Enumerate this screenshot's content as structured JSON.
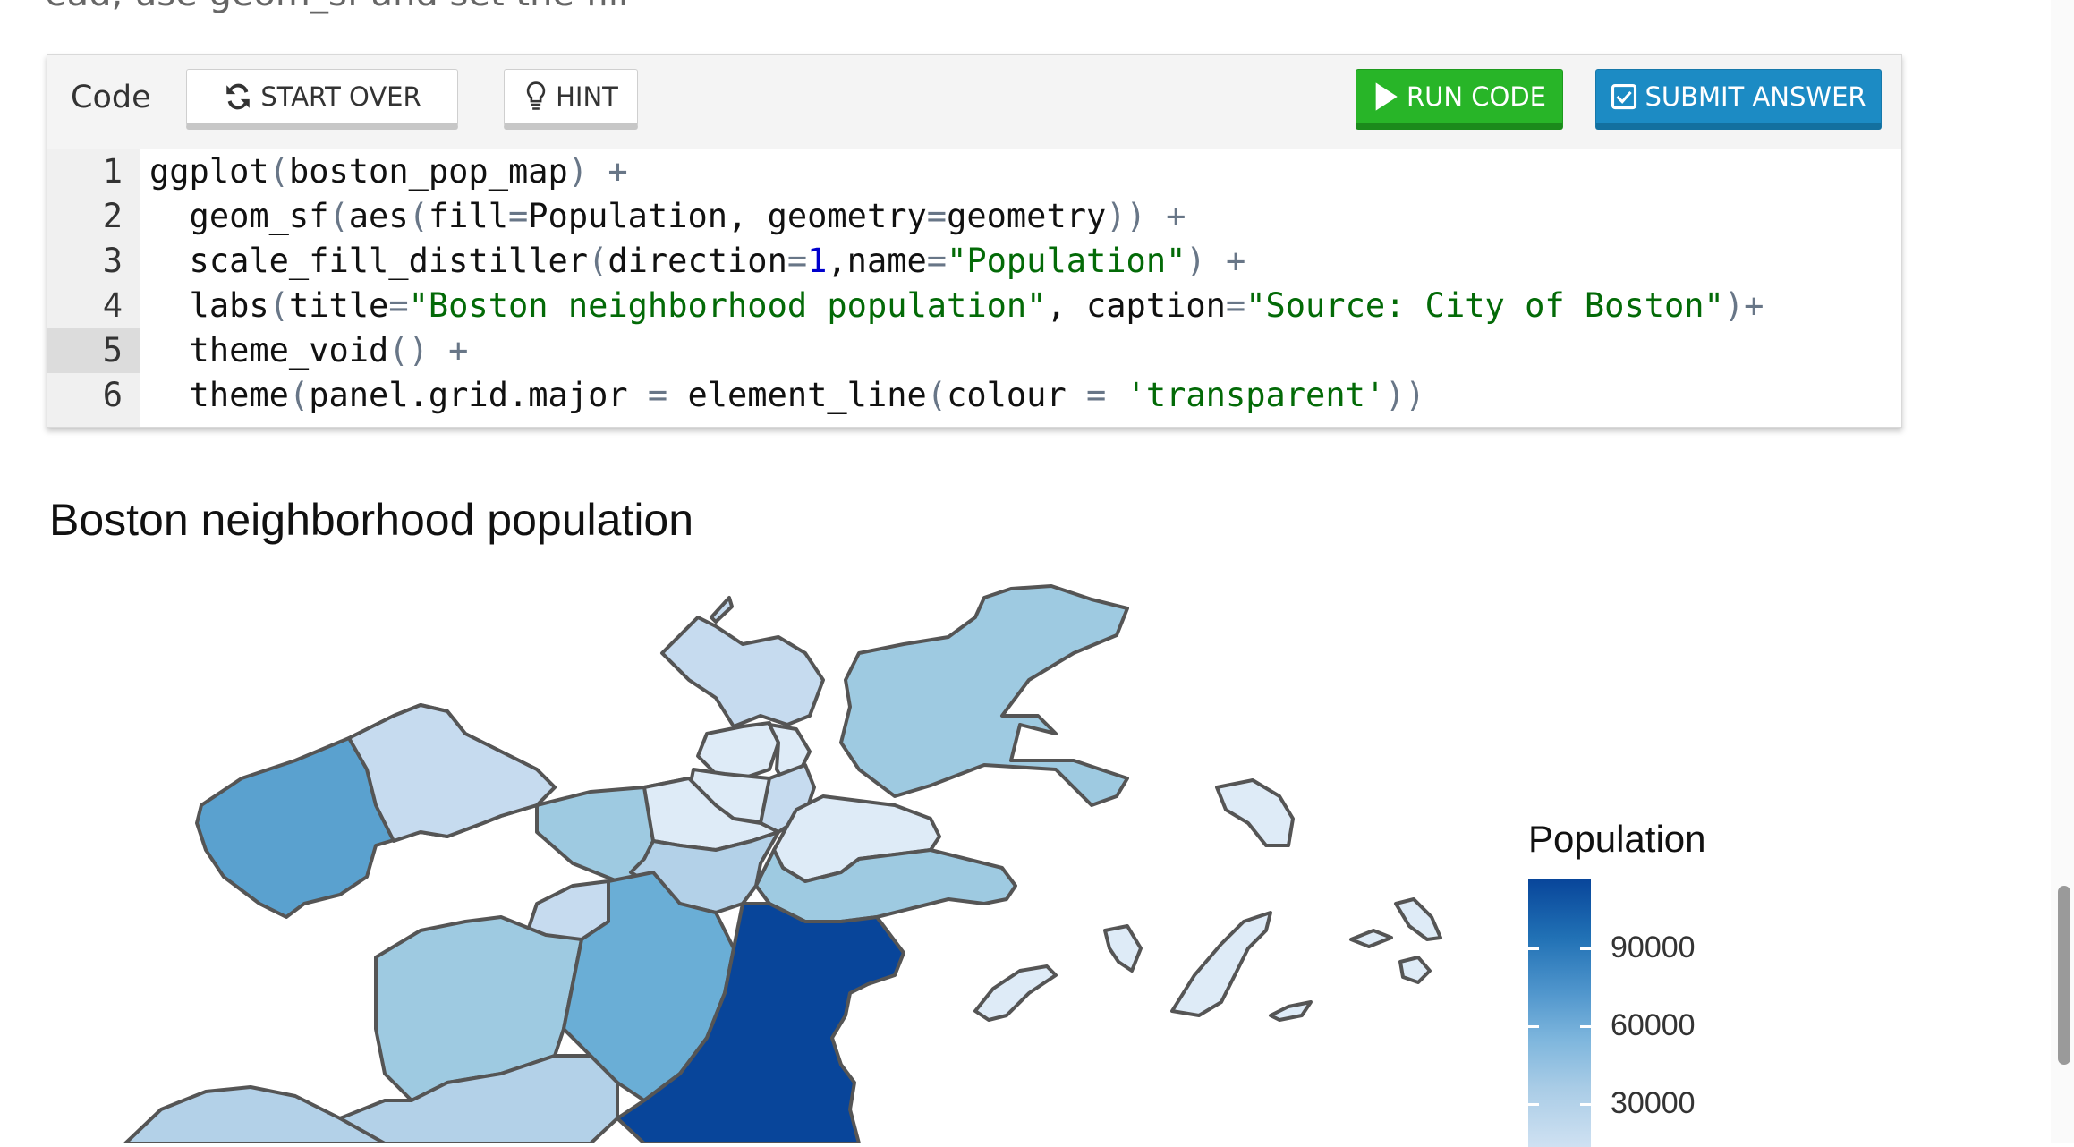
{
  "page": {
    "top_fragment": "ead, use geom_sf and set the fill"
  },
  "toolbar": {
    "code_label": "Code",
    "start_over_label": "START OVER",
    "hint_label": "HINT",
    "run_code_label": "RUN CODE",
    "submit_label": "SUBMIT ANSWER",
    "icons": {
      "start_over": "refresh-icon",
      "hint": "lightbulb-icon",
      "run": "play-icon",
      "submit": "checkbox-icon"
    },
    "colors": {
      "run": "#28b528",
      "submit": "#1c8bc4"
    }
  },
  "editor": {
    "active_line": 5,
    "lines": [
      {
        "num": "1",
        "tokens": [
          [
            "t",
            "ggplot"
          ],
          [
            "o",
            "("
          ],
          [
            "t",
            "boston_pop_map"
          ],
          [
            "o",
            ")"
          ],
          [
            "t",
            " "
          ],
          [
            "o",
            "+"
          ]
        ]
      },
      {
        "num": "2",
        "tokens": [
          [
            "t",
            "  geom_sf"
          ],
          [
            "o",
            "("
          ],
          [
            "t",
            "aes"
          ],
          [
            "o",
            "("
          ],
          [
            "t",
            "fill"
          ],
          [
            "o",
            "="
          ],
          [
            "t",
            "Population, geometry"
          ],
          [
            "o",
            "="
          ],
          [
            "t",
            "geometry"
          ],
          [
            "o",
            "))"
          ],
          [
            "t",
            " "
          ],
          [
            "o",
            "+"
          ]
        ]
      },
      {
        "num": "3",
        "tokens": [
          [
            "t",
            "  scale_fill_distiller"
          ],
          [
            "o",
            "("
          ],
          [
            "t",
            "direction"
          ],
          [
            "o",
            "="
          ],
          [
            "n",
            "1"
          ],
          [
            "t",
            ",name"
          ],
          [
            "o",
            "="
          ],
          [
            "s",
            "\"Population\""
          ],
          [
            "o",
            ")"
          ],
          [
            "t",
            " "
          ],
          [
            "o",
            "+"
          ]
        ]
      },
      {
        "num": "4",
        "tokens": [
          [
            "t",
            "  labs"
          ],
          [
            "o",
            "("
          ],
          [
            "t",
            "title"
          ],
          [
            "o",
            "="
          ],
          [
            "s",
            "\"Boston neighborhood population\""
          ],
          [
            "t",
            ", caption"
          ],
          [
            "o",
            "="
          ],
          [
            "s",
            "\"Source: City of Boston\""
          ],
          [
            "o",
            ")+"
          ]
        ]
      },
      {
        "num": "5",
        "tokens": [
          [
            "t",
            "  theme_void"
          ],
          [
            "o",
            "()"
          ],
          [
            "t",
            " "
          ],
          [
            "o",
            "+"
          ]
        ]
      },
      {
        "num": "6",
        "tokens": [
          [
            "t",
            "  theme"
          ],
          [
            "o",
            "("
          ],
          [
            "t",
            "panel.grid.major "
          ],
          [
            "o",
            "="
          ],
          [
            "t",
            " element_line"
          ],
          [
            "o",
            "("
          ],
          [
            "t",
            "colour "
          ],
          [
            "o",
            "="
          ],
          [
            "t",
            " "
          ],
          [
            "s",
            "'transparent'"
          ],
          [
            "o",
            "))"
          ]
        ]
      }
    ]
  },
  "plot": {
    "title": "Boston neighborhood population",
    "legend_title": "Population",
    "legend_ticks": [
      "90000",
      "60000",
      "30000"
    ]
  }
}
